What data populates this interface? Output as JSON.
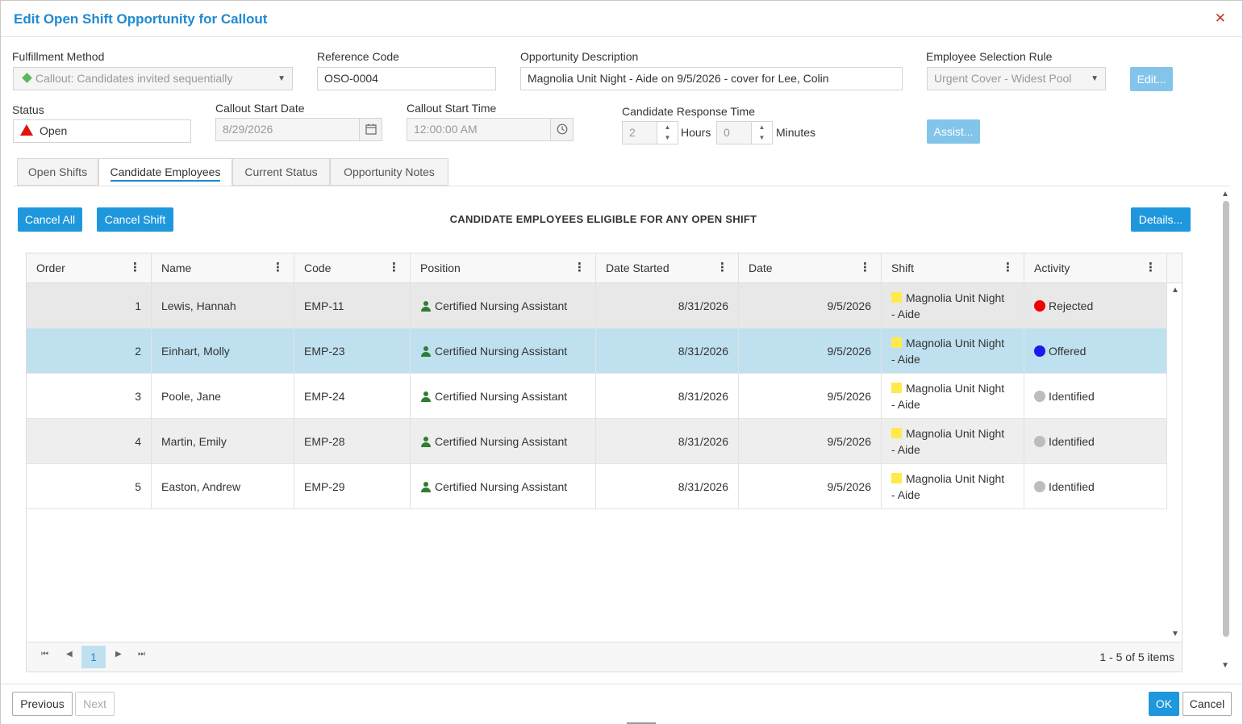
{
  "dialog": {
    "title": "Edit Open Shift Opportunity for Callout",
    "close_icon": "✕"
  },
  "form": {
    "fulfillment_method": {
      "label": "Fulfillment Method",
      "value": "Callout: Candidates invited sequentially"
    },
    "reference_code": {
      "label": "Reference Code",
      "value": "OSO-0004"
    },
    "opportunity_description": {
      "label": "Opportunity Description",
      "value": "Magnolia Unit Night - Aide on 9/5/2026 - cover for Lee, Colin"
    },
    "employee_selection_rule": {
      "label": "Employee Selection Rule",
      "value": "Urgent Cover - Widest Pool",
      "edit_button": "Edit..."
    },
    "status": {
      "label": "Status",
      "value": "Open"
    },
    "callout_start_date": {
      "label": "Callout Start Date",
      "value": "8/29/2026"
    },
    "callout_start_time": {
      "label": "Callout Start Time",
      "value": "12:00:00 AM"
    },
    "candidate_response_time": {
      "label": "Candidate Response Time",
      "hours_value": "2",
      "hours_label": "Hours",
      "minutes_value": "0",
      "minutes_label": "Minutes"
    },
    "assist_button": "Assist..."
  },
  "tabs": [
    {
      "label": "Open Shifts"
    },
    {
      "label": "Candidate Employees"
    },
    {
      "label": "Current Status"
    },
    {
      "label": "Opportunity Notes"
    }
  ],
  "toolbar": {
    "cancel_all": "Cancel All",
    "cancel_shift": "Cancel Shift",
    "section_title": "CANDIDATE EMPLOYEES ELIGIBLE FOR ANY OPEN SHIFT",
    "details": "Details..."
  },
  "grid": {
    "columns": [
      "Order",
      "Name",
      "Code",
      "Position",
      "Date Started",
      "Date",
      "Shift",
      "Activity"
    ],
    "rows": [
      {
        "order": "1",
        "name": "Lewis, Hannah",
        "code": "EMP-11",
        "position": "Certified Nursing Assistant",
        "date_started": "8/31/2026",
        "date": "9/5/2026",
        "shift_line1": "Magnolia Unit Night",
        "shift_line2": "- Aide",
        "activity": "Rejected",
        "activity_color": "#f00000"
      },
      {
        "order": "2",
        "name": "Einhart, Molly",
        "code": "EMP-23",
        "position": "Certified Nursing Assistant",
        "date_started": "8/31/2026",
        "date": "9/5/2026",
        "shift_line1": "Magnolia Unit Night",
        "shift_line2": "- Aide",
        "activity": "Offered",
        "activity_color": "#1a1aee"
      },
      {
        "order": "3",
        "name": "Poole, Jane",
        "code": "EMP-24",
        "position": "Certified Nursing Assistant",
        "date_started": "8/31/2026",
        "date": "9/5/2026",
        "shift_line1": "Magnolia Unit Night",
        "shift_line2": "- Aide",
        "activity": "Identified",
        "activity_color": "#bdbdbd"
      },
      {
        "order": "4",
        "name": "Martin, Emily",
        "code": "EMP-28",
        "position": "Certified Nursing Assistant",
        "date_started": "8/31/2026",
        "date": "9/5/2026",
        "shift_line1": "Magnolia Unit Night",
        "shift_line2": "- Aide",
        "activity": "Identified",
        "activity_color": "#bdbdbd"
      },
      {
        "order": "5",
        "name": "Easton, Andrew",
        "code": "EMP-29",
        "position": "Certified Nursing Assistant",
        "date_started": "8/31/2026",
        "date": "9/5/2026",
        "shift_line1": "Magnolia Unit Night",
        "shift_line2": "- Aide",
        "activity": "Identified",
        "activity_color": "#bdbdbd"
      }
    ],
    "pager": {
      "current_page": "1",
      "info": "1 - 5 of 5 items"
    }
  },
  "footer": {
    "previous": "Previous",
    "next": "Next",
    "ok": "OK",
    "cancel": "Cancel"
  },
  "colors": {
    "accent": "#1f97dd",
    "title": "#1f8ad0",
    "selected_row": "#bfe0ef",
    "shift_marker": "#ffe94d",
    "status_open": "#e0120f"
  }
}
